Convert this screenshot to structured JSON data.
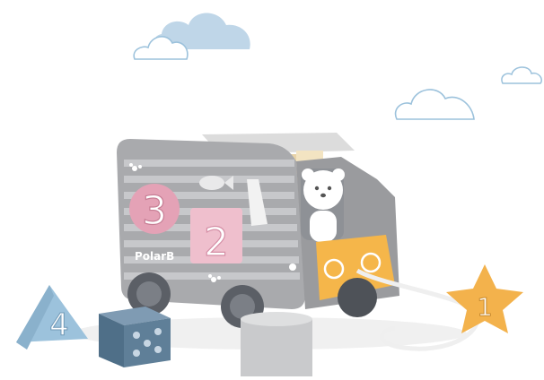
{
  "scene": {
    "description_free": true,
    "colors": {
      "background": "#ffffff",
      "cloud_blue": "#bfd6e8",
      "cloud_outline": "#9cc2dc",
      "truck_gray": "#a9aaad",
      "truck_stripe": "#c7c8cb",
      "cab_orange": "#f5b64a",
      "block_pink": "#e4a2b6",
      "block_pink_light": "#efbfcd",
      "block_blue": "#9cc2dc",
      "block_navy": "#5f7f98",
      "star_orange": "#f3b24c",
      "wood": "#e8d3a8"
    }
  },
  "toy": {
    "brand_label": "PolarB",
    "block_numbers": {
      "circle": "3",
      "square_pink": "2",
      "triangle": "4",
      "star": "1"
    }
  }
}
